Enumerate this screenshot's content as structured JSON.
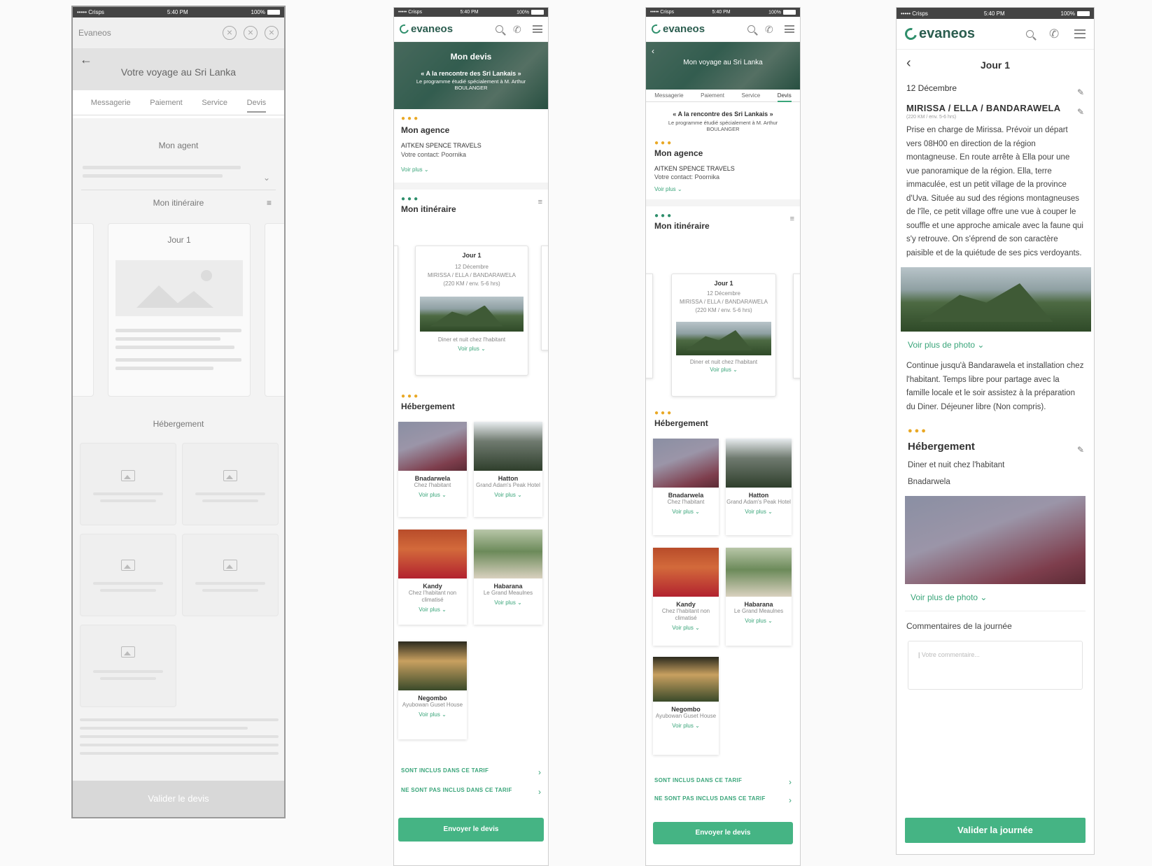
{
  "status": {
    "carrier": "••••• Crisps",
    "time": "5:40 PM",
    "battery": "100%"
  },
  "wireframe": {
    "brand": "Evaneos",
    "header_title": "Votre voyage au Sri Lanka",
    "back_icon": "←",
    "tabs": [
      "Messagerie",
      "Paiement",
      "Service",
      "Devis"
    ],
    "section_agent": "Mon agent",
    "section_itinerary": "Mon itinéraire",
    "day_title": "Jour 1",
    "section_accommodation": "Hébergement",
    "footer_button": "Valider le devis"
  },
  "screen2": {
    "hero_title": "Mon devis",
    "hero_subtitle": "« A la rencontre des Sri Lankais »",
    "hero_desc": "Le programme étudié spécialement à M. Arthur BOULANGER",
    "agency_title": "Mon agence",
    "agency_name": "AITKEN SPENCE TRAVELS",
    "agency_contact": "Votre contact: Poornika",
    "voir_plus": "Voir plus",
    "itinerary_title": "Mon itinéraire",
    "day": {
      "title": "Jour 1",
      "date": "12 Décembre",
      "route": "MIRISSA / ELLA / BANDARAWELA",
      "dist": "(220 KM / env. 5-6 hrs)",
      "stay": "Diner et nuit chez l'habitant",
      "more": "Voir plus"
    },
    "accommodation_title": "Hébergement",
    "hotels": [
      {
        "name": "Bnadarwela",
        "sub": "Chez l'habitant",
        "more": "Voir plus"
      },
      {
        "name": "Hatton",
        "sub": "Grand Adam's Peak Hotel",
        "more": "Voir plus"
      },
      {
        "name": "Kandy",
        "sub": "Chez l'habitant non climatisé",
        "more": "Voir plus"
      },
      {
        "name": "Habarana",
        "sub": "Le Grand Meaulnes",
        "more": "Voir plus"
      },
      {
        "name": "Negombo",
        "sub": "Ayubowan Guset House",
        "more": "Voir plus"
      }
    ],
    "included": "SONT INCLUS DANS CE TARIF",
    "not_included": "NE SONT PAS INCLUS DANS CE TARIF",
    "send_button": "Envoyer le devis"
  },
  "screen3": {
    "hero_title": "Mon voyage au Sri Lanka",
    "tabs": [
      "Messagerie",
      "Paiement",
      "Service",
      "Devis"
    ],
    "subtitle": "« A la rencontre des Sri Lankais »",
    "desc": "Le programme étudié spécialement à M. Arthur BOULANGER",
    "agency_title": "Mon agence",
    "agency_name": "AITKEN SPENCE TRAVELS",
    "agency_contact": "Votre contact: Poornika",
    "voir_plus": "Voir plus",
    "itinerary_title": "Mon itinéraire",
    "day": {
      "title": "Jour 1",
      "date": "12 Décembre",
      "route": "MIRISSA / ELLA / BANDARAWELA",
      "dist": "(220 KM / env. 5-6 hrs)",
      "stay": "Diner et nuit chez l'habitant",
      "more": "Voir plus"
    },
    "accommodation_title": "Hébergement",
    "hotels": [
      {
        "name": "Bnadarwela",
        "sub": "Chez l'habitant",
        "more": "Voir plus"
      },
      {
        "name": "Hatton",
        "sub": "Grand Adam's Peak Hotel",
        "more": "Voir plus"
      },
      {
        "name": "Kandy",
        "sub": "Chez l'habitant non climatisé",
        "more": "Voir plus"
      },
      {
        "name": "Habarana",
        "sub": "Le Grand Meaulnes",
        "more": "Voir plus"
      },
      {
        "name": "Negombo",
        "sub": "Ayubowan Guset House",
        "more": "Voir plus"
      }
    ],
    "included": "SONT INCLUS DANS CE TARIF",
    "not_included": "NE SONT PAS INCLUS DANS CE TARIF",
    "send_button": "Envoyer le devis"
  },
  "screen4": {
    "title": "Jour 1",
    "date": "12 Décembre",
    "route": "MIRISSA / ELLA / BANDARAWELA",
    "dist": "(220 KM / env. 5-6 hrs)",
    "paragraph1": "Prise en charge de Mirissa. Prévoir un départ vers 08H00 en direction de la région montagneuse. En route arrête à Ella pour une vue panoramique de la région. Ella, terre immaculée, est un petit village de la province d'Uva. Située au sud des régions montagneuses de l'île, ce petit village offre une vue à couper le souffle et une approche amicale avec la faune qui s'y retrouve. On s'éprend de son caractère paisible et de la quiétude de ses pics verdoyants.",
    "more_photo": "Voir plus de photo",
    "paragraph2": "Continue jusqu'à Bandarawela et installation chez l'habitant. Temps libre pour partage avec la famille locale et le soir assistez à la préparation du Diner. Déjeuner libre (Non compris).",
    "accommodation_title": "Hébergement",
    "stay": "Diner et nuit chez l'habitant",
    "place": "Bnadarwela",
    "more_photo2": "Voir plus de photo",
    "comments_label": "Commentaires de la journée",
    "comment_placeholder": "Votre commentaire...",
    "validate_button": "Valider la journée"
  }
}
